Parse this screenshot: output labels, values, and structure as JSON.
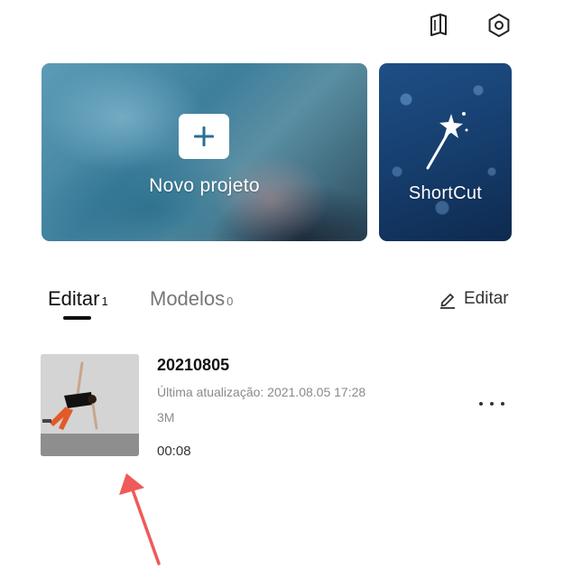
{
  "topbar": {
    "manual_icon": "book-icon",
    "settings_icon": "hexagon-gear-icon"
  },
  "cards": {
    "new_project": {
      "label": "Novo projeto",
      "icon": "plus-icon"
    },
    "shortcut": {
      "label": "ShortCut",
      "icon": "magic-wand-icon"
    }
  },
  "tabs": [
    {
      "label": "Editar",
      "count": "1",
      "active": true
    },
    {
      "label": "Modelos",
      "count": "0",
      "active": false
    }
  ],
  "edit_button": {
    "label": "Editar",
    "icon": "pencil-icon"
  },
  "project": {
    "title": "20210805",
    "updated": "Última atualização: 2021.08.05 17:28",
    "size": "3M",
    "duration": "00:08"
  },
  "colors": {
    "accent": "#111111",
    "arrow": "#f05a5a",
    "muted_text": "#8a8a8a"
  }
}
